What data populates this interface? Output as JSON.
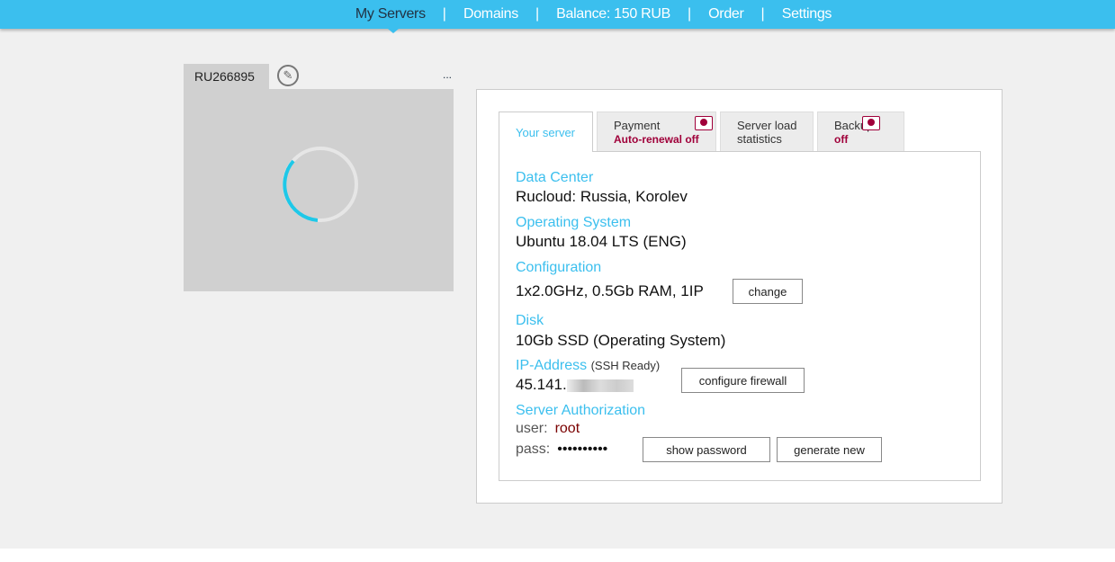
{
  "nav": {
    "items": [
      "My Servers",
      "Domains",
      "Balance: 150 RUB",
      "Order",
      "Settings"
    ]
  },
  "server": {
    "id": "RU266895",
    "more": "..."
  },
  "tabs": {
    "your_server": "Your server",
    "payment": "Payment",
    "payment_status": "Auto-renewal off",
    "load": "Server load",
    "load2": "statistics",
    "backup": "Backup",
    "backup_status": "off"
  },
  "details": {
    "dc_label": "Data Center",
    "dc": "Rucloud: Russia, Korolev",
    "os_label": "Operating System",
    "os": "Ubuntu 18.04 LTS (ENG)",
    "cfg_label": "Configuration",
    "cfg": "1x2.0GHz, 0.5Gb RAM, 1IP",
    "change": "change",
    "disk_label": "Disk",
    "disk": "10Gb SSD (Operating System)",
    "ip_label": "IP-Address",
    "ip_note": "(SSH Ready)",
    "ip": "45.141.",
    "firewall": "configure firewall",
    "auth_label": "Server Authorization",
    "user_label": "user:",
    "user": "root",
    "pass_label": "pass:",
    "pass": "••••••••••",
    "show": "show password",
    "generate": "generate new"
  }
}
